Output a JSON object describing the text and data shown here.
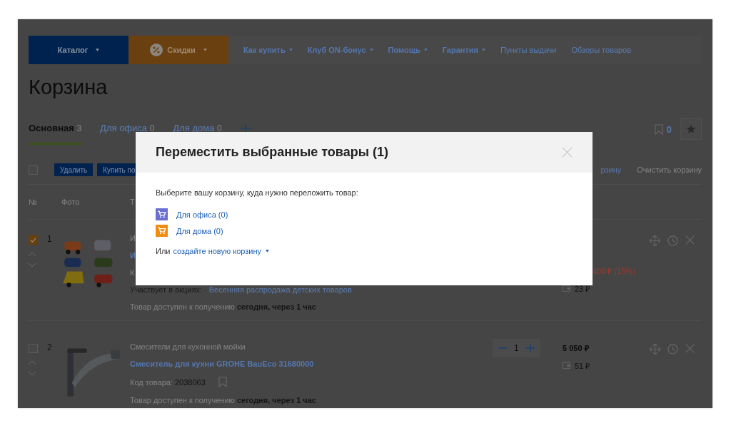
{
  "nav": {
    "menus": [
      {
        "label": "Каталог",
        "kind": "catalog"
      },
      {
        "label": "Скидки",
        "kind": "sale"
      }
    ],
    "links": [
      {
        "label": "Как купить",
        "dropdown": true
      },
      {
        "label": "Клуб ON-бонус",
        "dropdown": true
      },
      {
        "label": "Помощь",
        "dropdown": true
      },
      {
        "label": "Гарантия",
        "dropdown": true
      },
      {
        "label": "Пункты выдачи",
        "dropdown": false
      },
      {
        "label": "Обзоры товаров",
        "dropdown": false
      }
    ]
  },
  "title": "Корзина",
  "tabs": [
    {
      "label": "Основная",
      "count": "3",
      "selected": true
    },
    {
      "label": "Для офиса",
      "count": "0",
      "selected": false
    },
    {
      "label": "Для дома",
      "count": "0",
      "selected": false
    }
  ],
  "favorites": {
    "count": "0"
  },
  "toolbar": {
    "checked": false,
    "buttons": [
      "Удалить",
      "Купить по"
    ],
    "links": [
      "рзину",
      "Очистить корзину"
    ]
  },
  "columns": [
    "№",
    "Фото",
    "Т"
  ],
  "items": [
    {
      "number": "1",
      "checked": true,
      "category": "И",
      "title": "И",
      "code_label": "К",
      "promo_label": "Участвует в акциях: ·",
      "promo": "Весенняя распродажа детских товаров",
      "availability": "Товар доступен к получению **сегодня, через 1 час**",
      "discount": "400 ₽ (15%)",
      "bonus": "23 ₽"
    },
    {
      "number": "2",
      "checked": false,
      "category": "Смесители для кухонной мойки",
      "title": "Смеситель для кухни GROHE BauEco 31680000",
      "code_label": "Код товара:",
      "code": "2038063",
      "availability": "Товар доступен к получению **сегодня, через 1 час**",
      "quantity": "1",
      "price": "5 050 ₽",
      "bonus": "51 ₽"
    }
  ],
  "modal": {
    "title": "Переместить выбранные товары (1)",
    "prompt": "Выберите вашу корзину, куда нужно переложить товар:",
    "baskets": [
      {
        "label": "Для офиса (0)",
        "color": "#6b6fd1"
      },
      {
        "label": "Для дома (0)",
        "color": "#f28c0f"
      }
    ],
    "create_prefix": "Или",
    "create_link": "создайте новую корзину"
  }
}
